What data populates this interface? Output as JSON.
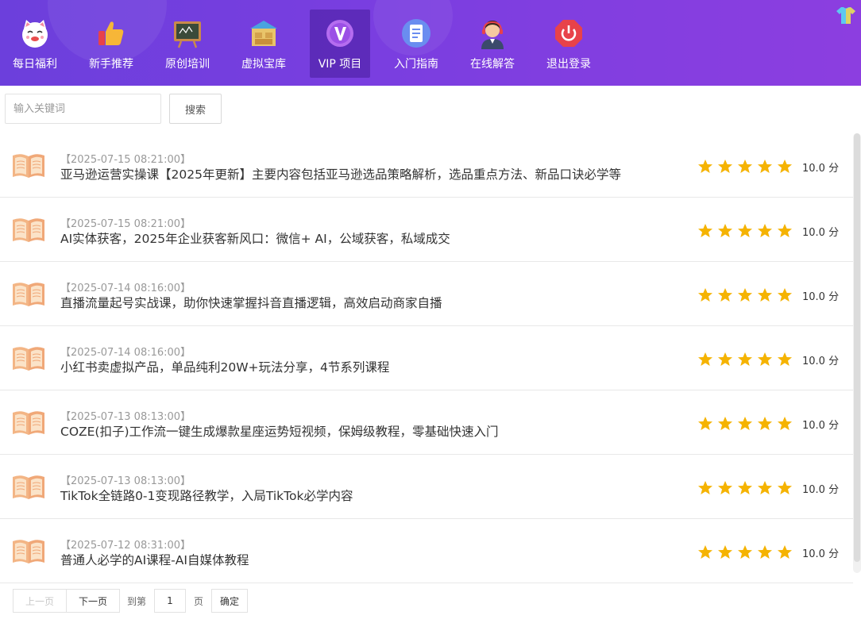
{
  "nav": {
    "items": [
      {
        "label": "每日福利",
        "icon": "lucky-cat-icon"
      },
      {
        "label": "新手推荐",
        "icon": "thumbs-up-icon"
      },
      {
        "label": "原创培训",
        "icon": "blackboard-icon"
      },
      {
        "label": "虚拟宝库",
        "icon": "warehouse-icon"
      },
      {
        "label": "VIP 项目",
        "icon": "vip-icon",
        "active": true
      },
      {
        "label": "入门指南",
        "icon": "document-icon"
      },
      {
        "label": "在线解答",
        "icon": "customer-service-icon"
      },
      {
        "label": "退出登录",
        "icon": "power-icon"
      }
    ],
    "skin_icon": "tshirt-icon"
  },
  "search": {
    "placeholder": "输入关键词",
    "value": "",
    "button_label": "搜索"
  },
  "articles": [
    {
      "date": "【2025-07-15 08:21:00】",
      "title": "亚马逊运营实操课【2025年更新】主要内容包括亚马逊选品策略解析，选品重点方法、新品口诀必学等",
      "rating": 5,
      "score": "10.0 分"
    },
    {
      "date": "【2025-07-15 08:21:00】",
      "title": "AI实体获客，2025年企业获客新风口：微信+ AI，公域获客，私域成交",
      "rating": 5,
      "score": "10.0 分"
    },
    {
      "date": "【2025-07-14 08:16:00】",
      "title": "直播流量起号实战课，助你快速掌握抖音直播逻辑，高效启动商家自播",
      "rating": 5,
      "score": "10.0 分"
    },
    {
      "date": "【2025-07-14 08:16:00】",
      "title": "小红书卖虚拟产品，单品纯利20W+玩法分享，4节系列课程",
      "rating": 5,
      "score": "10.0 分"
    },
    {
      "date": "【2025-07-13 08:13:00】",
      "title": "COZE(扣子)工作流一键生成爆款星座运势短视频，保姆级教程，零基础快速入门",
      "rating": 5,
      "score": "10.0 分"
    },
    {
      "date": "【2025-07-13 08:13:00】",
      "title": "TikTok全链路0-1变现路径教学，入局TikTok必学内容",
      "rating": 5,
      "score": "10.0 分"
    },
    {
      "date": "【2025-07-12 08:31:00】",
      "title": "普通人必学的AI课程-AI自媒体教程",
      "rating": 5,
      "score": "10.0 分"
    }
  ],
  "pagination": {
    "prev_label": "上一页",
    "next_label": "下一页",
    "goto_label": "到第",
    "page_value": "1",
    "page_suffix": "页",
    "confirm_label": "确定"
  },
  "colors": {
    "header_start": "#6c3fdc",
    "header_end": "#8c3ee0",
    "star": "#f5b301",
    "book": "#f0a878"
  }
}
